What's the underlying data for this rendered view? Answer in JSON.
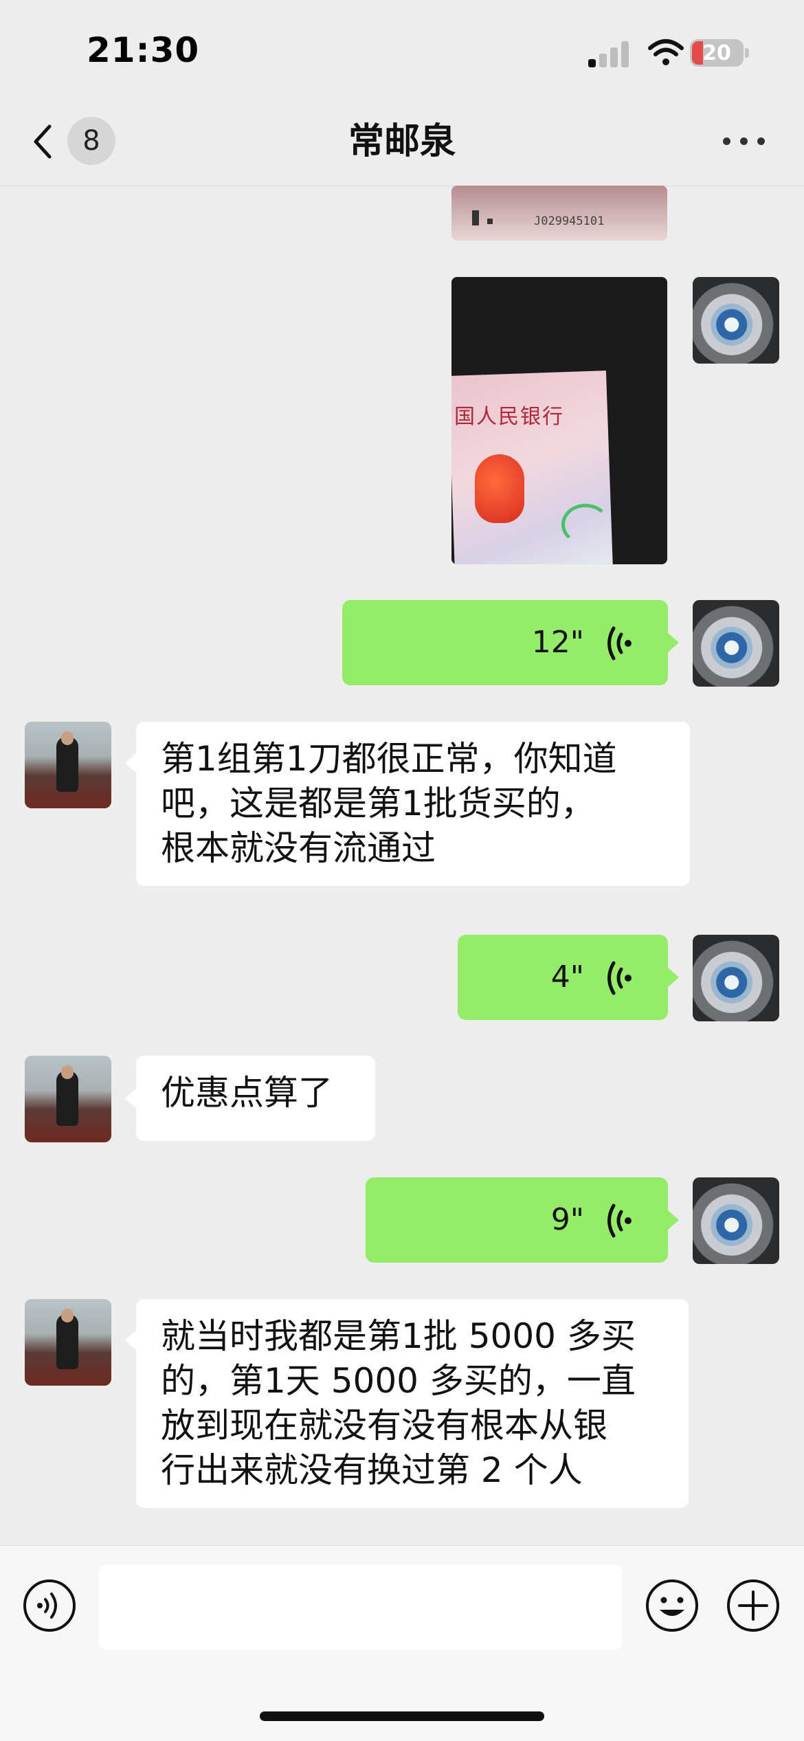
{
  "status_bar": {
    "time": "21:30",
    "battery": "20"
  },
  "nav": {
    "unread_count": "8",
    "title": "常邮泉"
  },
  "photos": {
    "top_serial": "J029945101",
    "main_note_text": "国人民银行"
  },
  "messages": [
    {
      "id": "m1",
      "side": "right",
      "type": "voice",
      "duration": "12\""
    },
    {
      "id": "m2",
      "side": "left",
      "type": "text",
      "lines": [
        "第1组第1刀都很正常，你知道",
        "吧，这是都是第1批货买的，",
        "根本就没有流通过"
      ]
    },
    {
      "id": "m3",
      "side": "right",
      "type": "voice",
      "duration": "4\""
    },
    {
      "id": "m4",
      "side": "left",
      "type": "text",
      "lines": [
        "优惠点算了"
      ]
    },
    {
      "id": "m5",
      "side": "right",
      "type": "voice",
      "duration": "9\""
    },
    {
      "id": "m6",
      "side": "left",
      "type": "text",
      "lines": [
        "就当时我都是第1批 5000 多买",
        "的，第1天 5000 多买的，一直",
        "放到现在就没有没有根本从银",
        "行出来就没有换过第 2 个人"
      ]
    }
  ],
  "input": {
    "placeholder": "",
    "value": ""
  },
  "colors": {
    "background": "#ededed",
    "sent_bubble": "#95ec69",
    "received_bubble": "#ffffff"
  },
  "icons": [
    "back-icon",
    "more-icon",
    "voice-wave-icon",
    "voice-toggle-icon",
    "emoji-icon",
    "plus-icon"
  ]
}
